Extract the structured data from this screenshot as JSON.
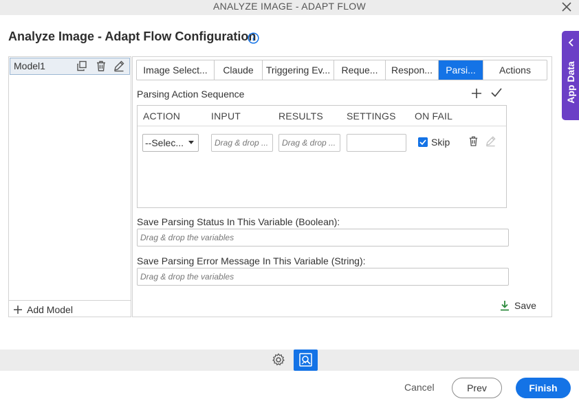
{
  "window": {
    "title": "ANALYZE IMAGE - ADAPT FLOW",
    "close_icon": "close-icon"
  },
  "page": {
    "title": "Analyze Image - Adapt Flow Configuration",
    "info_icon": "info-icon"
  },
  "models": {
    "items": [
      {
        "label": "Model1",
        "icons": [
          "duplicate-icon",
          "trash-icon",
          "pencil-icon"
        ]
      }
    ],
    "add_label": "Add Model"
  },
  "tabs": [
    {
      "label": "Image Select...",
      "active": false
    },
    {
      "label": "Claude",
      "active": false
    },
    {
      "label": "Triggering Ev...",
      "active": false
    },
    {
      "label": "Reque...",
      "active": false
    },
    {
      "label": "Respon...",
      "active": false
    },
    {
      "label": "Parsi...",
      "active": true
    },
    {
      "label": "Actions",
      "active": false
    }
  ],
  "parsing": {
    "title": "Parsing Action Sequence",
    "columns": [
      "ACTION",
      "INPUT",
      "RESULTS",
      "SETTINGS",
      "ON FAIL"
    ],
    "rows": [
      {
        "action": "--Selec...",
        "input_placeholder": "Drag & drop ...",
        "results_placeholder": "Drag & drop ...",
        "settings": "",
        "on_fail_checked": true,
        "on_fail_label": "Skip"
      }
    ],
    "status_label": "Save Parsing Status In This Variable (Boolean):",
    "status_placeholder": "Drag & drop the variables",
    "error_label": "Save Parsing Error Message In This Variable (String):",
    "error_placeholder": "Drag & drop the variables",
    "save_label": "Save"
  },
  "app_data": {
    "label": "App Data"
  },
  "footer": {
    "cancel_label": "Cancel",
    "prev_label": "Prev",
    "finish_label": "Finish"
  },
  "colors": {
    "accent": "#1473e6",
    "app_data_tab": "#6b3fc6",
    "save_icon": "#2e8b3e"
  }
}
